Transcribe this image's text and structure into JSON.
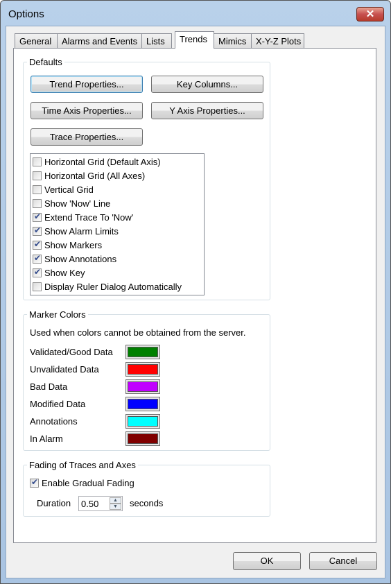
{
  "window": {
    "title": "Options",
    "close_icon": "close-icon"
  },
  "tabs": [
    "General",
    "Alarms and Events",
    "Lists",
    "Trends",
    "Mimics",
    "X-Y-Z Plots"
  ],
  "active_tab": "Trends",
  "defaults": {
    "label": "Defaults",
    "buttons": {
      "trend": "Trend Properties...",
      "key": "Key Columns...",
      "time": "Time Axis Properties...",
      "yaxis": "Y Axis Properties...",
      "trace": "Trace Properties..."
    },
    "options": [
      {
        "label": "Horizontal Grid (Default Axis)",
        "checked": false
      },
      {
        "label": "Horizontal Grid (All Axes)",
        "checked": false
      },
      {
        "label": "Vertical Grid",
        "checked": false
      },
      {
        "label": "Show 'Now' Line",
        "checked": false
      },
      {
        "label": "Extend Trace To 'Now'",
        "checked": true
      },
      {
        "label": "Show Alarm Limits",
        "checked": true
      },
      {
        "label": "Show Markers",
        "checked": true
      },
      {
        "label": "Show Annotations",
        "checked": true
      },
      {
        "label": "Show Key",
        "checked": true
      },
      {
        "label": "Display Ruler Dialog Automatically",
        "checked": false
      }
    ]
  },
  "marker_colors": {
    "label": "Marker Colors",
    "note": "Used when colors cannot be obtained from the server.",
    "items": [
      {
        "label": "Validated/Good Data",
        "color": "#008000"
      },
      {
        "label": "Unvalidated Data",
        "color": "#ff0000"
      },
      {
        "label": "Bad Data",
        "color": "#c000ff"
      },
      {
        "label": "Modified Data",
        "color": "#0000ff"
      },
      {
        "label": "Annotations",
        "color": "#00ffff"
      },
      {
        "label": "In Alarm",
        "color": "#800000"
      }
    ]
  },
  "fading": {
    "label": "Fading of Traces and Axes",
    "enable_label": "Enable Gradual Fading",
    "enabled": true,
    "duration_label": "Duration",
    "duration": "0.50",
    "unit": "seconds"
  },
  "footer": {
    "ok": "OK",
    "cancel": "Cancel"
  }
}
